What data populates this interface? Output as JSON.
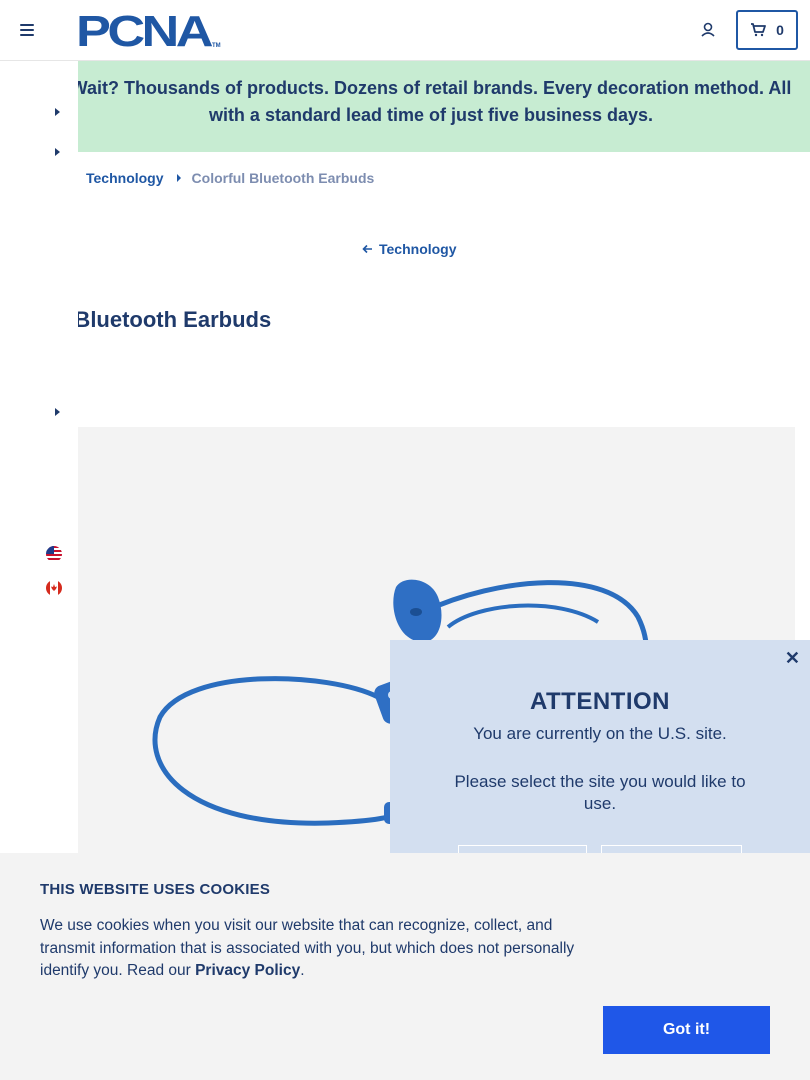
{
  "header": {
    "logo_text": "PCNA",
    "logo_tm": "TM",
    "cart_count": "0"
  },
  "banner": {
    "line1": "Wait? Thousands of products. Dozens of retail brands. Every decoration method. All",
    "line2": "with a standard lead time of just five business days."
  },
  "breadcrumb": {
    "parent": "Technology",
    "current": "Colorful Bluetooth Earbuds"
  },
  "back_link": "Technology",
  "product": {
    "title": "Colorful Bluetooth Earbuds"
  },
  "modal": {
    "title": "ATTENTION",
    "line1": "You are currently on the U.S. site.",
    "line2": "Please select the site you would like to use."
  },
  "cookie": {
    "title": "THIS WEBSITE USES COOKIES",
    "text": "We use cookies when you visit our website that can recognize, collect, and transmit information that is associated with you, but which does not personally identify you. Read our ",
    "link": "Privacy Policy",
    "period": ".",
    "button": "Got it!"
  },
  "colors": {
    "brand_blue": "#1f57a4",
    "navy": "#1f3a6b",
    "banner_green": "#c7ecd2",
    "modal_blue": "#d3dff0",
    "button_blue": "#1f57e8"
  }
}
